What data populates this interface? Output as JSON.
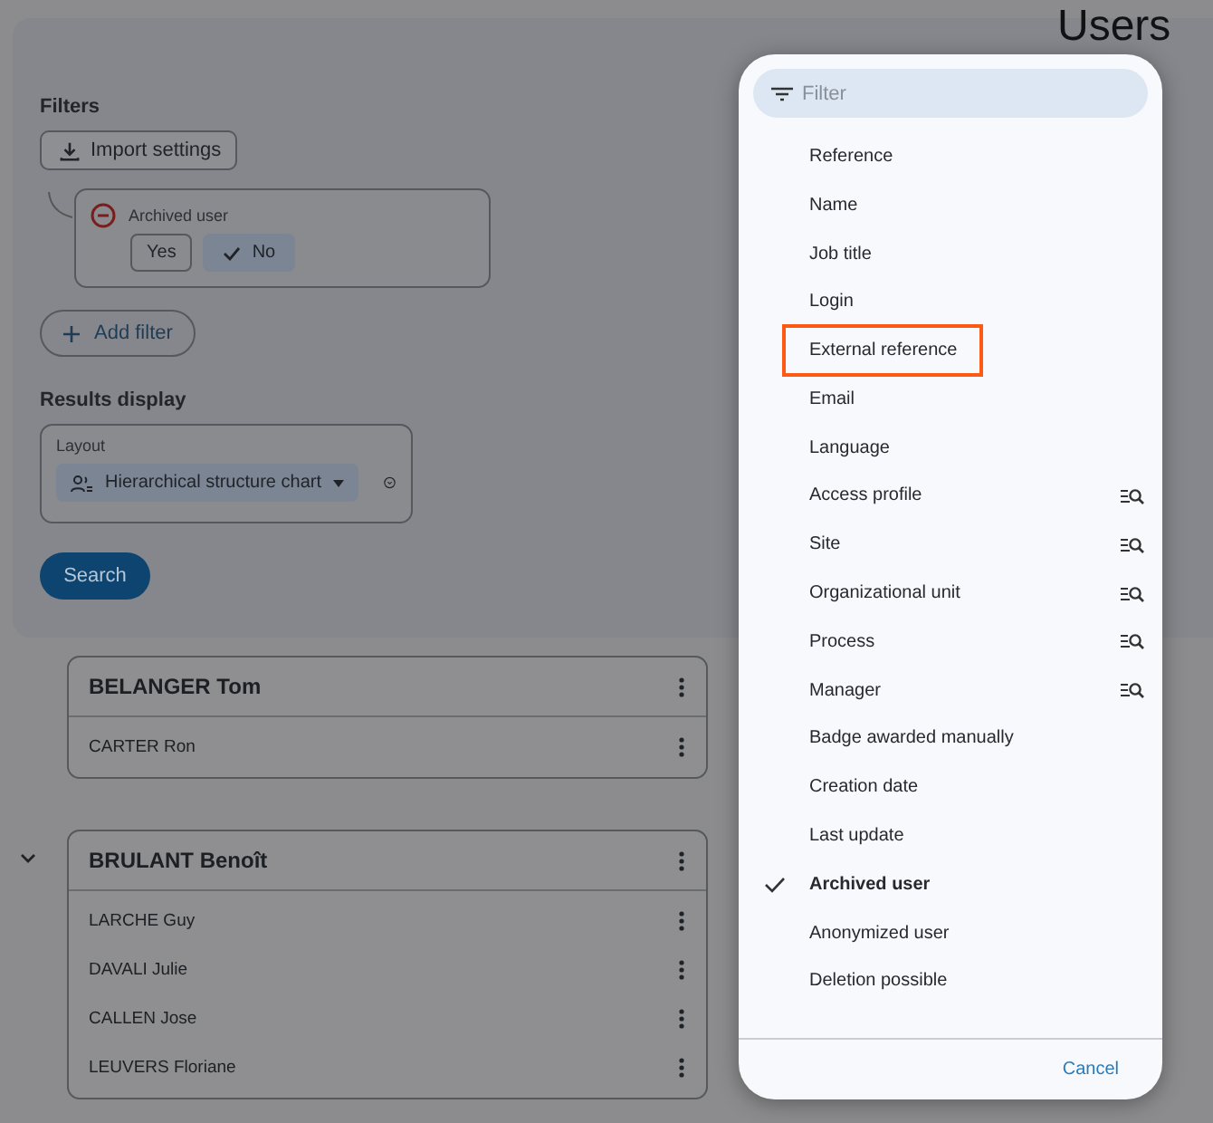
{
  "page": {
    "title": "Users"
  },
  "filters": {
    "heading": "Filters",
    "import_button": "Import settings",
    "active": [
      {
        "label": "Archived user",
        "options": [
          {
            "label": "Yes",
            "selected": false
          },
          {
            "label": "No",
            "selected": true
          }
        ]
      }
    ],
    "add_button": "Add filter"
  },
  "results": {
    "heading": "Results display",
    "layout_label": "Layout",
    "layout_value": "Hierarchical structure chart"
  },
  "search_button": "Search",
  "groups": [
    {
      "name": "BELANGER Tom",
      "members": [
        "CARTER Ron"
      ]
    },
    {
      "name": "BRULANT Benoît",
      "expanded": true,
      "members": [
        "LARCHE Guy",
        "DAVALI Julie",
        "CALLEN Jose",
        "LEUVERS Floriane"
      ]
    }
  ],
  "menu": {
    "placeholder": "Filter",
    "items": [
      {
        "label": "Reference",
        "kind": "plain",
        "checked": false,
        "highlighted": false
      },
      {
        "label": "Name",
        "kind": "plain",
        "checked": false,
        "highlighted": false
      },
      {
        "label": "Job title",
        "kind": "plain",
        "checked": false,
        "highlighted": false
      },
      {
        "label": "Login",
        "kind": "plain",
        "checked": false,
        "highlighted": false
      },
      {
        "label": "External reference",
        "kind": "plain",
        "checked": false,
        "highlighted": true
      },
      {
        "label": "Email",
        "kind": "plain",
        "checked": false,
        "highlighted": false
      },
      {
        "label": "Language",
        "kind": "plain",
        "checked": false,
        "highlighted": false
      },
      {
        "label": "Access profile",
        "kind": "lookup",
        "checked": false,
        "highlighted": false
      },
      {
        "label": "Site",
        "kind": "lookup",
        "checked": false,
        "highlighted": false
      },
      {
        "label": "Organizational unit",
        "kind": "lookup",
        "checked": false,
        "highlighted": false
      },
      {
        "label": "Process",
        "kind": "lookup",
        "checked": false,
        "highlighted": false
      },
      {
        "label": "Manager",
        "kind": "lookup",
        "checked": false,
        "highlighted": false
      },
      {
        "label": "Badge awarded manually",
        "kind": "plain",
        "checked": false,
        "highlighted": false
      },
      {
        "label": "Creation date",
        "kind": "plain",
        "checked": false,
        "highlighted": false
      },
      {
        "label": "Last update",
        "kind": "plain",
        "checked": false,
        "highlighted": false
      },
      {
        "label": "Archived user",
        "kind": "plain",
        "checked": true,
        "highlighted": false
      },
      {
        "label": "Anonymized user",
        "kind": "plain",
        "checked": false,
        "highlighted": false
      },
      {
        "label": "Deletion possible",
        "kind": "plain",
        "checked": false,
        "highlighted": false
      }
    ],
    "cancel": "Cancel"
  }
}
